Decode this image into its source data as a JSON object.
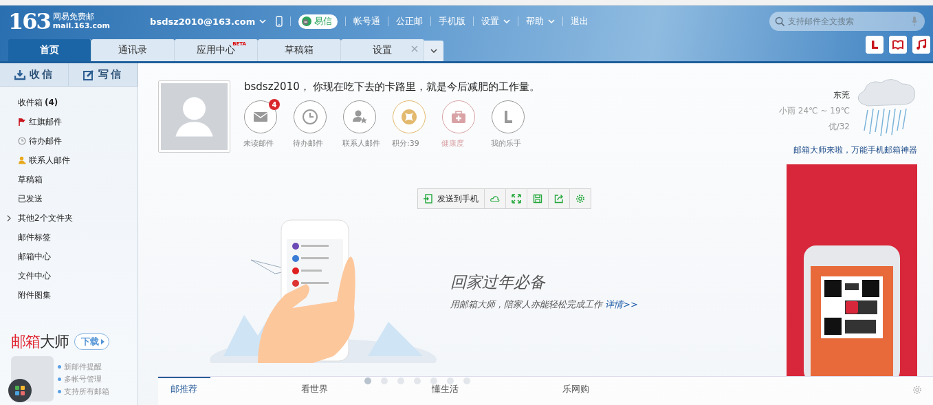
{
  "header": {
    "logo": {
      "number": "163",
      "name": "网易免费邮",
      "domain": "mail.163.com"
    },
    "account": "bsdsz2010@163.com",
    "yixin": "易信",
    "links": [
      {
        "label": "帐号通",
        "dropdown": false
      },
      {
        "label": "公正邮",
        "dropdown": false
      },
      {
        "label": "手机版",
        "dropdown": false
      },
      {
        "label": "设置",
        "dropdown": true
      },
      {
        "label": "帮助",
        "dropdown": true
      },
      {
        "label": "退出",
        "dropdown": false
      }
    ],
    "search": {
      "placeholder": "支持邮件全文搜索"
    }
  },
  "tabs": [
    {
      "label": "首页",
      "selected": true
    },
    {
      "label": "通讯录",
      "selected": false
    },
    {
      "label": "应用中心",
      "selected": false,
      "badge": "BETA"
    },
    {
      "label": "草稿箱",
      "selected": false
    },
    {
      "label": "设置",
      "selected": false,
      "closable": true
    }
  ],
  "sidebar": {
    "actions": [
      {
        "label": "收信",
        "kind": "receive"
      },
      {
        "label": "写信",
        "kind": "compose"
      }
    ],
    "folders": [
      {
        "label": "收件箱",
        "count": "(4)",
        "kind": "plain"
      },
      {
        "label": "红旗邮件",
        "kind": "flag"
      },
      {
        "label": "待办邮件",
        "kind": "clock"
      },
      {
        "label": "联系人邮件",
        "kind": "contact"
      },
      {
        "label": "草稿箱",
        "kind": "plain"
      },
      {
        "label": "已发送",
        "kind": "plain"
      },
      {
        "label": "其他2个文件夹",
        "kind": "group",
        "expanded": false
      },
      {
        "label": "邮件标签",
        "kind": "plain"
      },
      {
        "label": "邮箱中心",
        "kind": "plain"
      },
      {
        "label": "文件中心",
        "kind": "plain"
      },
      {
        "label": "附件图集",
        "kind": "plain"
      }
    ],
    "promo": {
      "brand_accent": "邮箱",
      "brand_rest": "大师",
      "download": "下载",
      "features": [
        "新邮件提醒",
        "多帐号管理",
        "支持所有邮箱"
      ]
    }
  },
  "greeting": "bsdsz2010， 你现在吃下去的卡路里，就是今后减肥的工作量。",
  "shortcuts": [
    {
      "label": "未读邮件",
      "kind": "mail",
      "badge": "4",
      "color": "#999999"
    },
    {
      "label": "待办邮件",
      "kind": "clock",
      "color": "#999999"
    },
    {
      "label": "联系人邮件",
      "kind": "contact",
      "color": "#999999"
    },
    {
      "label": "积分:39",
      "kind": "score",
      "color": "#e3b96e"
    },
    {
      "label": "健康度",
      "kind": "health",
      "color": "#d9a3a6"
    },
    {
      "label": "我的乐手",
      "kind": "lefu",
      "color": "#999999"
    }
  ],
  "toolbar": {
    "send_to_phone": "发送到手机"
  },
  "banner": {
    "title": "回家过年必备",
    "subtitle": "用邮箱大师，陪家人亦能轻松完成工作",
    "link": "详情>>",
    "dots": [
      {
        "selected": true
      },
      {
        "selected": false
      },
      {
        "selected": false
      },
      {
        "selected": false
      },
      {
        "selected": false
      },
      {
        "selected": false
      },
      {
        "selected": false
      }
    ]
  },
  "news_tabs": [
    {
      "label": "邮推荐",
      "selected": true
    },
    {
      "label": "看世界",
      "selected": false
    },
    {
      "label": "懂生活",
      "selected": false
    },
    {
      "label": "乐网购",
      "selected": false
    }
  ],
  "weather": {
    "city": "东莞",
    "condition": "小雨 24℃ ~ 19℃",
    "air": "优/32"
  },
  "promo_link": "邮箱大师来啦，万能手机邮箱神器"
}
